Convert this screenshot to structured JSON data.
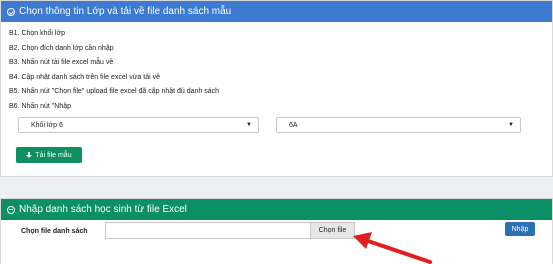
{
  "panel_top": {
    "title": "Chọn thông tin Lớp và tải về file danh sách mẫu",
    "steps": [
      "B1. Chọn khối lớp",
      "B2. Chọn đích danh lớp cần nhập",
      "B3. Nhấn nút tải file excel mẫu về",
      "B4. Cập nhật danh sách trên file excel vừa tải về",
      "B5. Nhấn nút \"Chọn file\" upload file excel đã cập nhật đủ danh sách",
      "B6. Nhấn nút \"Nhập"
    ],
    "grade_select": "Khối lớp 6",
    "class_select": "6A",
    "download_button": "Tải file mẫu"
  },
  "panel_bottom": {
    "title": "Nhập danh sách học sinh từ file Excel",
    "file_label": "Chọn file danh sách",
    "choose_file_button": "Chọn file",
    "import_button": "Nhập"
  },
  "colors": {
    "header_blue": "#3c7bd1",
    "header_green": "#0b8f64",
    "arrow_red": "#e02020"
  }
}
